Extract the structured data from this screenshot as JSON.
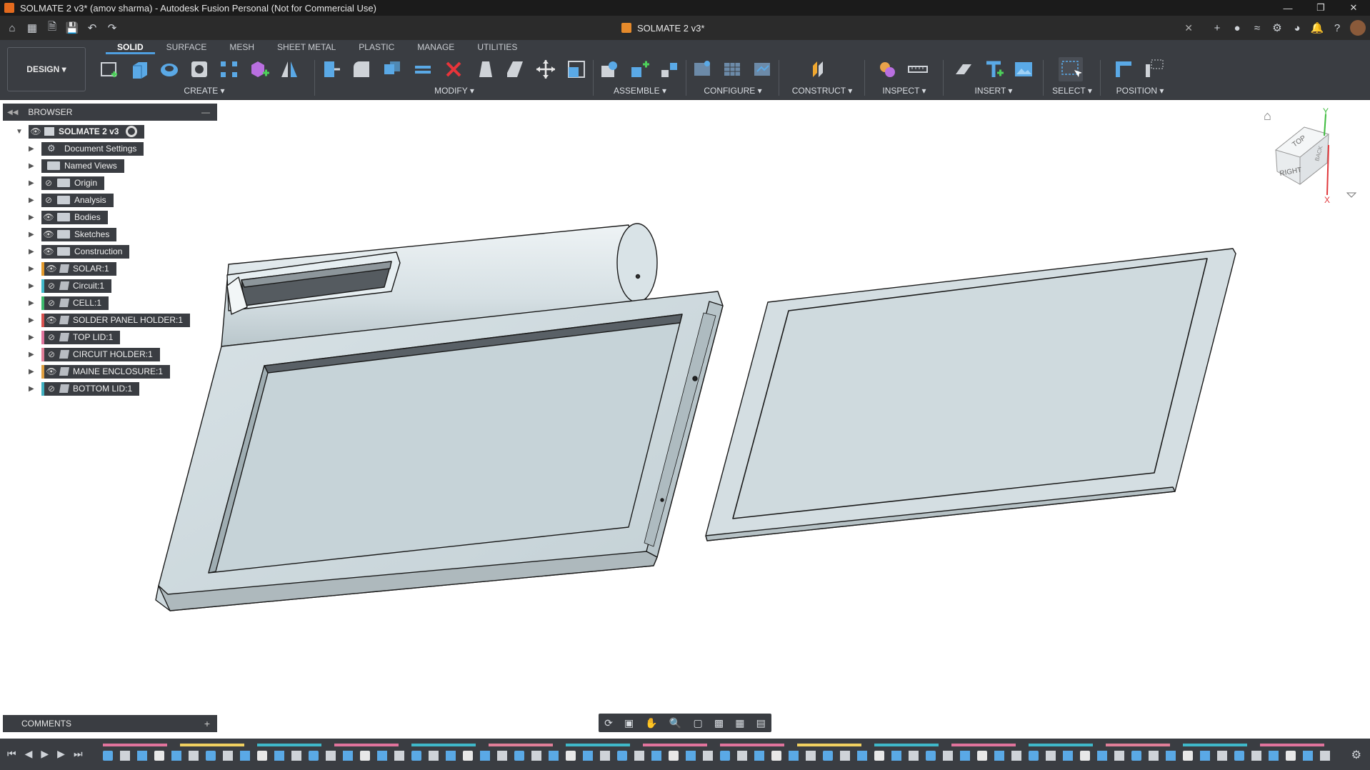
{
  "window": {
    "title": "SOLMATE 2 v3* (amov sharma) - Autodesk Fusion Personal (Not for Commercial Use)",
    "controls": [
      "minimize",
      "restore",
      "close"
    ]
  },
  "quick_access": {
    "document_tab": "SOLMATE 2 v3*",
    "icons": [
      "home-icon",
      "grid-icon",
      "file-icon",
      "save-icon",
      "undo-icon",
      "redo-icon"
    ],
    "right_icons": [
      "add-tab-icon",
      "online-status-icon",
      "jobs-icon",
      "extensions-icon",
      "account-sync-icon",
      "notifications-icon",
      "help-icon",
      "avatar"
    ]
  },
  "toolbar": {
    "workspace": "DESIGN",
    "tabs": [
      "SOLID",
      "SURFACE",
      "MESH",
      "SHEET METAL",
      "PLASTIC",
      "MANAGE",
      "UTILITIES"
    ],
    "active_tab": "SOLID",
    "groups": [
      {
        "label": "CREATE",
        "icons": [
          "create-sketch-icon",
          "extrude-icon",
          "revolve-icon",
          "hole-icon",
          "pattern-icon",
          "new-component-icon",
          "mirror-icon"
        ]
      },
      {
        "label": "MODIFY",
        "icons": [
          "press-pull-icon",
          "fillet-icon",
          "combine-icon",
          "shell-icon",
          "delete-icon",
          "draft-icon",
          "split-face-icon",
          "move-icon",
          "scale-icon"
        ]
      },
      {
        "label": "ASSEMBLE",
        "icons": [
          "joint-icon",
          "new-component-icon",
          "as-built-joint-icon"
        ]
      },
      {
        "label": "CONFIGURE",
        "icons": [
          "configure-icon",
          "table-icon",
          "parameters-icon"
        ]
      },
      {
        "label": "CONSTRUCT",
        "icons": [
          "offset-plane-icon"
        ]
      },
      {
        "label": "INSPECT",
        "icons": [
          "section-analysis-icon",
          "measure-icon"
        ]
      },
      {
        "label": "INSERT",
        "icons": [
          "insert-derive-icon",
          "text-icon",
          "canvas-icon"
        ]
      },
      {
        "label": "SELECT",
        "icons": [
          "select-window-icon"
        ]
      },
      {
        "label": "POSITION",
        "icons": [
          "align-icon",
          "capture-position-icon"
        ]
      }
    ],
    "accent": "#4f9fe0"
  },
  "browser": {
    "title": "BROWSER",
    "root": {
      "label": "SOLMATE 2 v3"
    },
    "items": [
      {
        "label": "Document Settings",
        "icon": "gear-icon",
        "visible": null,
        "strip": null
      },
      {
        "label": "Named Views",
        "icon": "folder-icon",
        "visible": null,
        "strip": null
      },
      {
        "label": "Origin",
        "icon": "folder-icon",
        "visible": false,
        "strip": null
      },
      {
        "label": "Analysis",
        "icon": "folder-icon",
        "visible": false,
        "strip": null
      },
      {
        "label": "Bodies",
        "icon": "folder-icon",
        "visible": true,
        "strip": null
      },
      {
        "label": "Sketches",
        "icon": "folder-icon",
        "visible": true,
        "strip": null
      },
      {
        "label": "Construction",
        "icon": "folder-icon",
        "visible": true,
        "strip": null
      },
      {
        "label": "SOLAR:1",
        "icon": "component-icon",
        "visible": true,
        "strip": "#e39a2b"
      },
      {
        "label": "Circuit:1",
        "icon": "component-icon",
        "visible": false,
        "strip": "#3fb8c9"
      },
      {
        "label": "CELL:1",
        "icon": "component-icon",
        "visible": false,
        "strip": "#3cb86c"
      },
      {
        "label": "SOLDER PANEL HOLDER:1",
        "icon": "component-icon",
        "visible": true,
        "strip": "#d9524f"
      },
      {
        "label": "TOP LID:1",
        "icon": "component-icon",
        "visible": false,
        "strip": "#e0739c"
      },
      {
        "label": "CIRCUIT HOLDER:1",
        "icon": "component-icon",
        "visible": false,
        "strip": "#e07e98"
      },
      {
        "label": "MAINE ENCLOSURE:1",
        "icon": "component-icon",
        "visible": true,
        "strip": "#e0a040"
      },
      {
        "label": "BOTTOM LID:1",
        "icon": "component-icon",
        "visible": false,
        "strip": "#3fb0c0"
      }
    ]
  },
  "viewcube": {
    "faces": [
      "TOP",
      "RIGHT",
      "BACK"
    ],
    "axes": [
      "Y",
      "X"
    ]
  },
  "comments": {
    "title": "COMMENTS"
  },
  "navbar": {
    "icons": [
      "orbit-icon",
      "pan-icon",
      "look-at-icon",
      "zoom-icon",
      "fit-icon",
      "display-settings-icon",
      "grid-icon",
      "viewports-icon"
    ]
  },
  "timeline": {
    "icons": [
      "go-to-start-icon",
      "previous-step-icon",
      "play-icon",
      "next-step-icon",
      "go-to-end-icon",
      "timeline-settings-icon"
    ]
  },
  "colors": {
    "model_face": "#d4dee2",
    "model_edge": "#1a1a1a",
    "toolbar_bg": "#3a3d42",
    "titlebar_bg": "#1b1b1b"
  }
}
